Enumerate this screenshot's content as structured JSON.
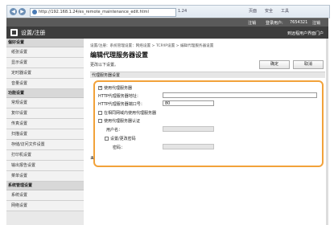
{
  "browser": {
    "url": "http://192.168.1.24/es_remote_maintenance_edit.html",
    "zoom": "1.24",
    "tools": [
      "页面",
      "安全",
      "工具"
    ]
  },
  "header": {
    "logout": "注销",
    "user_label": "登录用户:",
    "user_value": "7654321",
    "logout_btn": "注销"
  },
  "title_bar": {
    "app_title": "设置/注册",
    "portal_link": "到远程用户界面门户"
  },
  "sidebar": {
    "groups": [
      {
        "head": "偏好设置",
        "items": [
          "纸张设置",
          "显示设置",
          "定时器设置",
          "音量设置"
        ]
      },
      {
        "head": "功能设置",
        "items": [
          "常规设置",
          "复印设置",
          "传真设置",
          "扫描设置",
          "存储/访问文件设置",
          "打印机设置",
          "输出报告设置",
          "菜单设置"
        ]
      },
      {
        "head": "系统管理设置",
        "items": [
          "系统设置",
          "网络设置"
        ]
      }
    ]
  },
  "main": {
    "breadcrumb": "设置/注册：系统管理设置：网络设置 > TCP/IP设置 > 编辑代理服务器设置",
    "page_title": "编辑代理服务器设置",
    "instruction": "更改以下设置。",
    "ok_label": "确定",
    "cancel_label": "取消",
    "section_title": "代理服务器设置",
    "use_proxy_label": "使用代理服务器",
    "use_proxy_checked": true,
    "address_label": "HTTP代理服务器地址：",
    "address_value": "",
    "port_label": "HTTP代理服务器端口号：",
    "port_value": "80",
    "same_domain_label": "在相同网域内使用代理服务器",
    "same_domain_checked": false,
    "auth_label": "使用代理服务器认证",
    "auth_checked": false,
    "username_label": "用户名：",
    "username_value": "",
    "set_password_label": "设置/更改密码",
    "set_password_checked": false,
    "password_label": "密码：",
    "password_value": "",
    "footer_mark": "±"
  }
}
